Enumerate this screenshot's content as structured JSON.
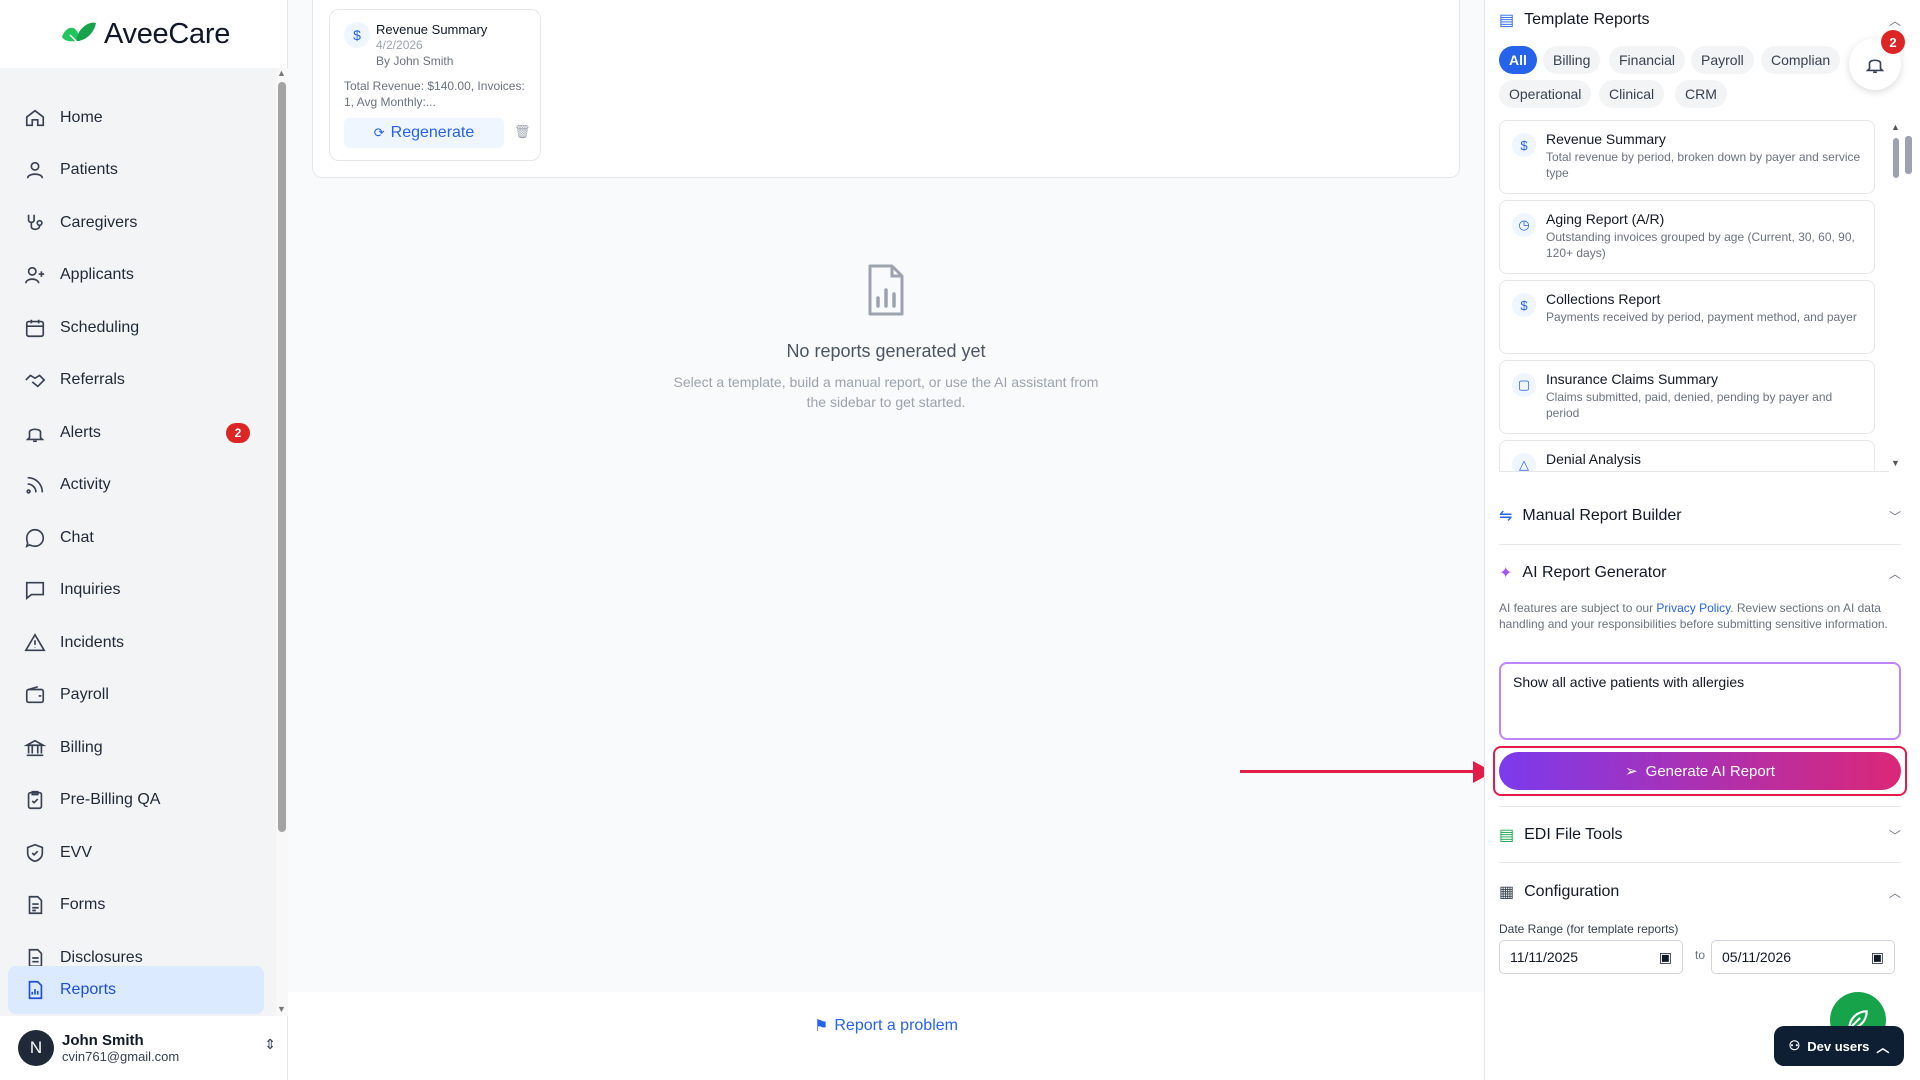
{
  "app": {
    "brand": "AveeCare"
  },
  "sidebar": {
    "items": [
      {
        "label": "Home",
        "icon": "home-icon"
      },
      {
        "label": "Patients",
        "icon": "user-icon"
      },
      {
        "label": "Caregivers",
        "icon": "stethoscope-icon"
      },
      {
        "label": "Applicants",
        "icon": "user-plus-icon"
      },
      {
        "label": "Scheduling",
        "icon": "calendar-icon"
      },
      {
        "label": "Referrals",
        "icon": "handshake-icon"
      },
      {
        "label": "Alerts",
        "icon": "bell-icon",
        "badge": "2"
      },
      {
        "label": "Activity",
        "icon": "rss-icon"
      },
      {
        "label": "Chat",
        "icon": "chat-bubble-icon"
      },
      {
        "label": "Inquiries",
        "icon": "message-square-icon"
      },
      {
        "label": "Incidents",
        "icon": "warning-triangle-icon"
      },
      {
        "label": "Payroll",
        "icon": "wallet-icon"
      },
      {
        "label": "Billing",
        "icon": "bank-icon"
      },
      {
        "label": "Pre-Billing QA",
        "icon": "clipboard-check-icon"
      },
      {
        "label": "EVV",
        "icon": "shield-check-icon"
      },
      {
        "label": "Forms",
        "icon": "form-icon"
      },
      {
        "label": "Disclosures",
        "icon": "document-icon"
      },
      {
        "label": "Reports",
        "icon": "report-icon",
        "active": true
      }
    ]
  },
  "user": {
    "initial": "N",
    "name": "John Smith",
    "email": "cvin761@gmail.com"
  },
  "main": {
    "generated_report": {
      "icon": "$",
      "title": "Revenue Summary",
      "date": "4/2/2026",
      "author": "By John Smith",
      "summary": "Total Revenue: $140.00, Invoices: 1, Avg Monthly:...",
      "regenerate_label": "Regenerate"
    },
    "empty": {
      "title": "No reports generated yet",
      "description": "Select a template, build a manual report, or use the AI assistant from the sidebar to get started."
    },
    "report_problem": "Report a problem"
  },
  "right_panel": {
    "template_reports": {
      "title": "Template Reports",
      "chips": [
        "All",
        "Billing",
        "Financial",
        "Payroll",
        "Complian",
        "Operational",
        "Clinical",
        "CRM"
      ],
      "active_chip": "All",
      "notification_count": "2",
      "templates": [
        {
          "icon": "$",
          "name": "Revenue Summary",
          "desc": "Total revenue by period, broken down by payer and service type"
        },
        {
          "icon": "◷",
          "name": "Aging Report (A/R)",
          "desc": "Outstanding invoices grouped by age (Current, 30, 60, 90, 120+ days)"
        },
        {
          "icon": "$",
          "name": "Collections Report",
          "desc": "Payments received by period, payment method, and payer"
        },
        {
          "icon": "▢",
          "name": "Insurance Claims Summary",
          "desc": "Claims submitted, paid, denied, pending by payer and period"
        },
        {
          "icon": "△",
          "name": "Denial Analysis",
          "desc": ""
        }
      ]
    },
    "manual_builder": {
      "title": "Manual Report Builder"
    },
    "ai_generator": {
      "title": "AI Report Generator",
      "note_prefix": "AI features are subject to our ",
      "privacy_link": "Privacy Policy",
      "note_suffix": ". Review sections on AI data handling and your responsibilities before submitting sensitive information.",
      "prompt_value": "Show all active patients with allergies",
      "generate_label": "Generate AI Report"
    },
    "edi_tools": {
      "title": "EDI File Tools"
    },
    "configuration": {
      "title": "Configuration",
      "date_range_label": "Date Range (for template reports)",
      "from": "11/11/2025",
      "to_label": "to",
      "to": "05/11/2026"
    },
    "dev_users": "Dev users"
  },
  "colors": {
    "accent": "#2563eb",
    "danger": "#dc2626",
    "ai_gradient_start": "#7c3aed",
    "ai_gradient_end": "#db2777",
    "annotation": "#e11d48"
  }
}
